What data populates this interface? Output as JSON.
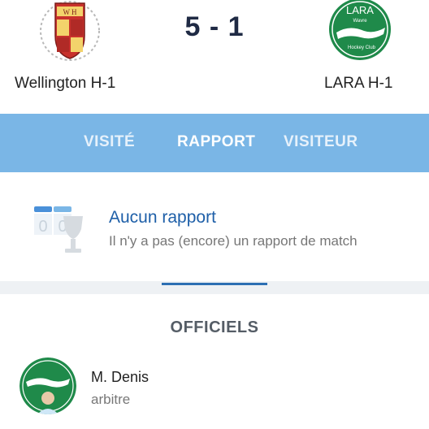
{
  "match": {
    "score": "5 - 1",
    "home_team": "Wellington H-1",
    "away_team": "LARA H-1",
    "away_logo_text": {
      "name": "LARA",
      "city": "Wavre",
      "club": "Hockey Club"
    }
  },
  "tabs": [
    {
      "label": "VISITÉ",
      "active": false
    },
    {
      "label": "RAPPORT",
      "active": true
    },
    {
      "label": "VISITEUR",
      "active": false
    }
  ],
  "report": {
    "title": "Aucun rapport",
    "subtitle": "Il n'y a pas (encore) un rapport de match"
  },
  "officials": {
    "title": "OFFICIELS",
    "items": [
      {
        "name": "M. Denis",
        "role": "arbitre"
      }
    ]
  },
  "colors": {
    "tab_bar": "#7ab6e6",
    "accent": "#1e5fa8",
    "lara_green": "#1f8a4a"
  }
}
